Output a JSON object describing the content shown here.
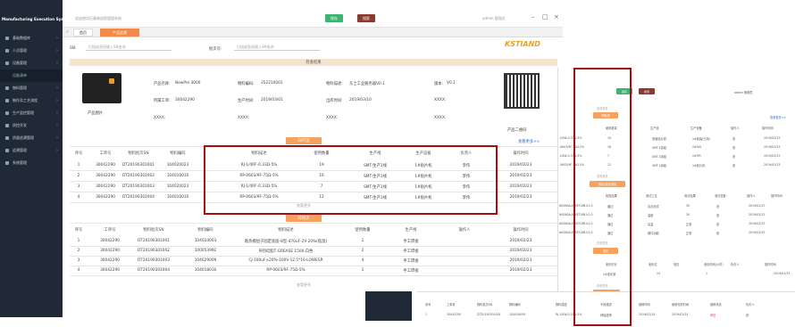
{
  "sidebar": {
    "title": "Manufacturing Execution System",
    "items": [
      "基础数据库",
      "人员管理",
      "设备管理",
      "设备清单",
      "物料管理",
      "制作及工艺流程",
      "生产监控管理",
      "质控开发",
      "质量追溯管理",
      "追溯管理",
      "系统管理"
    ]
  },
  "topbar": {
    "left_text": "欢迎使用石墨烯追踪管理系统",
    "btn_save": "保存",
    "btn_search": "搜索",
    "user": "admin 管理员"
  },
  "tabs": [
    "首页",
    "产品追溯"
  ],
  "search": {
    "sn_label": "SN:",
    "sn_placeholder": "扫描或直接输入SN查询",
    "batch_label": "批次号:",
    "batch_placeholder": "扫描或直接输入SN查询"
  },
  "logo": "KSTIAND",
  "check_band": "检查结果",
  "product": {
    "name_label": "产品名称:",
    "name": "NewPre 3000",
    "code_label": "物料编码:",
    "code": "352210001",
    "model_label": "物料描述:",
    "model": "东士工业服务器V0.1",
    "ver_label": "版本:",
    "ver": "V0.1",
    "unit_label": "所属工单:",
    "unit": "30042290",
    "date_label": "生产时间:",
    "date": "2019/03/01",
    "out_label": "出库时间:",
    "out": "2019/03/10",
    "x_label": "XXXX:",
    "img_label": "产品图片",
    "qr_label": "产品二维码",
    "emt_btn": "EMT流",
    "more_link": "查看更多>>"
  },
  "emt": {
    "headers": [
      "序号",
      "工单号",
      "物料批次SN",
      "物料编码",
      "物料描述",
      "使用数量",
      "生产线",
      "生产设备",
      "负责人",
      "操作时间"
    ],
    "rows": [
      [
        "1",
        "30042290",
        "DT20190301001",
        "104020023",
        "RJ-1/4RF-0.33Ω-5%",
        "19",
        "SMT-生产1线",
        "1#贴片机",
        "李伟",
        "2019/02/23"
      ],
      [
        "2",
        "30042290",
        "DT20190301002",
        "104010010",
        "RP-0603/9F-75Ω-5%",
        "16",
        "SMT-生产1线",
        "1#贴片机",
        "李伟",
        "2019/02/23"
      ],
      [
        "3",
        "30042290",
        "DT20190301003",
        "104020023",
        "RJ-1/4RF-0.33Ω-5%",
        "7",
        "SMT-生产1线",
        "1#贴片机",
        "李伟",
        "2019/02/23"
      ],
      [
        "4",
        "30042290",
        "DT20190301004",
        "104010010",
        "RP-0603/9F-75Ω-5%",
        "12",
        "SMT-生产1线",
        "1#贴片机",
        "李伟",
        "2019/02/23"
      ]
    ],
    "more": "查看更多"
  },
  "weld": {
    "btn": "焊接流",
    "headers": [
      "序号",
      "工单号",
      "物料批次SN",
      "物料编码",
      "物料描述",
      "使用数量",
      "生产线",
      "操作人",
      "操作时间"
    ],
    "rows": [
      [
        "1",
        "30042290",
        "DT20190301001",
        "104024003",
        "散热模组于固定底座-8型-470uF-2V-20%(低温)",
        "1",
        "手工焊接",
        "",
        "2019/02/23"
      ],
      [
        "2",
        "30042290",
        "DT20190301002",
        "100053992",
        "导热硅脂T-GREASE 1500-白色",
        "2",
        "手工焊接",
        "",
        "2019/02/23"
      ],
      [
        "3",
        "30042290",
        "DT20190301003",
        "104029009",
        "CJ-100uF±20%-100V-12.5*16-LOWESR",
        "4",
        "手工焊接",
        "",
        "2019/02/23"
      ],
      [
        "4",
        "30042290",
        "DT20190301004",
        "104018016",
        "RP-0603/9F-75Ω-5%",
        "1",
        "手工焊接",
        "",
        "2019/02/23"
      ]
    ],
    "more": "查看更多"
  },
  "panel": {
    "user": "admin 管理员",
    "save": "保存",
    "search": "搜索",
    "more1": "查看更多",
    "btn1": "焊接流",
    "link1": "查看更多>>",
    "h1": [
      "使用数量",
      "生产线",
      "生产设备",
      "操作人",
      "操作时间"
    ],
    "r1": [
      [
        "19",
        "双面贴片线",
        "1#贴装(已用)",
        "张",
        "2019/02/23"
      ],
      [
        "16",
        "SMT-1线组",
        "2#AOI",
        "张",
        "2019/02/23"
      ],
      [
        "7",
        "SMT-1线组",
        "2#SPI",
        "张",
        "2019/02/23"
      ],
      [
        "12",
        "SMT-1线组",
        "1#贴片机",
        "张",
        "2019/02/23"
      ]
    ],
    "l1": [
      "-U4W-0.33Ω-5%",
      "-0603/9F-75Ω-5%",
      "-U4W-0.33Ω-5%",
      "-0603/9F-75Ω-5%"
    ],
    "more2": "查看更多",
    "btn2": "测包/老化测试",
    "h2": [
      "检查结果",
      "测试工位",
      "测试结果",
      "测试总数",
      "操作人",
      "操作时间"
    ],
    "r2": [
      [
        "通过",
        "兆合测试",
        "30",
        "张",
        "2019/02/23"
      ],
      [
        "通过",
        "温度",
        "30",
        "张",
        "2019/02/23"
      ],
      [
        "通过",
        "高温",
        "正常",
        "张",
        "2019/02/23"
      ],
      [
        "通过",
        "硬件功能",
        "正常",
        "张",
        "2019/02/23"
      ]
    ],
    "l2": [
      "N0080A-ATSET-MB-V1.0",
      "N0080A-ATSET-MB-V1.0",
      "N0080A-ATSET-MB-V1.0",
      "N0080A-ATSET-MB-V1.0"
    ],
    "more3": "查看更多",
    "btn3": "老化",
    "h3": [
      "老化时长",
      "老化位",
      "电压",
      "老化时间(小时)",
      "负责人",
      "操作时间"
    ],
    "r3": [
      "1#老化架",
      "24",
      "1",
      "2019/02/23"
    ],
    "more4": "查看更多",
    "btn4": "维修记录"
  },
  "bottom": {
    "headers": [
      "序号",
      "工单号",
      "物料批次SN",
      "物料编码",
      "物料描述",
      "不良描述",
      "维修时间",
      "维修完成时间",
      "维修状态",
      "负责人"
    ],
    "row": [
      "1",
      "30042290",
      "DT20190301001",
      "104020009",
      "RJ-1/4W-0.33Ω-5%",
      "焊接虚焊",
      "2019/02/24",
      "2019/02/24",
      "修复",
      "张"
    ]
  }
}
